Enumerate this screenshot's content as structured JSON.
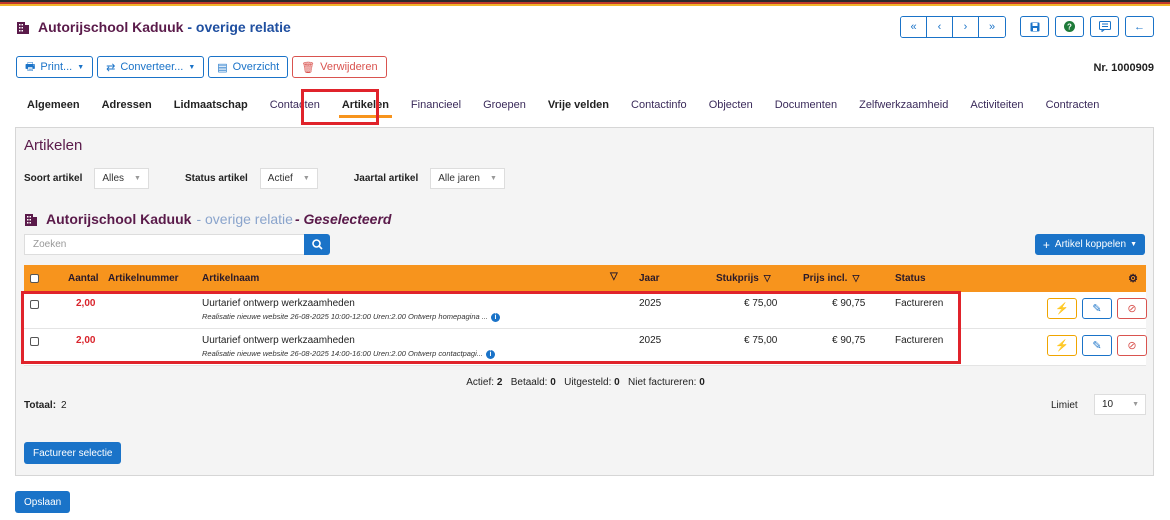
{
  "header": {
    "title": "Autorijschool Kaduuk",
    "subtitle": "- overige relatie",
    "nav_icons": [
      "double-chevron-left-icon",
      "chevron-left-icon",
      "chevron-right-icon",
      "double-chevron-right-icon"
    ],
    "action_icons": [
      "save-icon",
      "help-icon",
      "comment-icon",
      "arrow-left-icon"
    ]
  },
  "toolbar": {
    "print_label": "Print...",
    "convert_label": "Converteer...",
    "overview_label": "Overzicht",
    "delete_label": "Verwijderen",
    "record_number": "Nr. 1000909"
  },
  "tabs": [
    {
      "label": "Algemeen"
    },
    {
      "label": "Adressen"
    },
    {
      "label": "Lidmaatschap"
    },
    {
      "label": "Contacten"
    },
    {
      "label": "Artikelen"
    },
    {
      "label": "Financieel"
    },
    {
      "label": "Groepen"
    },
    {
      "label": "Vrije velden"
    },
    {
      "label": "Contactinfo"
    },
    {
      "label": "Objecten"
    },
    {
      "label": "Documenten"
    },
    {
      "label": "Zelfwerkzaamheid"
    },
    {
      "label": "Activiteiten"
    },
    {
      "label": "Contracten"
    }
  ],
  "panel": {
    "title": "Artikelen",
    "filters": {
      "soort_label": "Soort artikel",
      "soort_value": "Alles",
      "status_label": "Status artikel",
      "status_value": "Actief",
      "jaartal_label": "Jaartal artikel",
      "jaartal_value": "Alle jaren"
    },
    "subheader": {
      "name": "Autorijschool Kaduuk",
      "type": "- overige relatie",
      "selected": "- Geselecteerd"
    },
    "search_placeholder": "Zoeken",
    "koppelen_label": "Artikel koppelen"
  },
  "table": {
    "columns": {
      "aantal": "Aantal",
      "artikelnummer": "Artikelnummer",
      "artikelnaam": "Artikelnaam",
      "jaar": "Jaar",
      "stukprijs": "Stukprijs",
      "prijs_incl": "Prijs incl.",
      "status": "Status"
    },
    "rows": [
      {
        "aantal": "2,00",
        "artikelnummer": "",
        "artikelnaam": "Uurtarief ontwerp werkzaamheden",
        "omschrijving": "Realisatie nieuwe website 26-08-2025 10:00-12:00 Uren:2.00 Ontwerp homepagina ...",
        "jaar": "2025",
        "stukprijs": "€ 75,00",
        "prijs_incl": "€ 90,75",
        "status": "Factureren"
      },
      {
        "aantal": "2,00",
        "artikelnummer": "",
        "artikelnaam": "Uurtarief ontwerp werkzaamheden",
        "omschrijving": "Realisatie nieuwe website 26-08-2025 14:00-16:00 Uren:2.00 Ontwerp contactpagi...",
        "jaar": "2025",
        "stukprijs": "€ 75,00",
        "prijs_incl": "€ 90,75",
        "status": "Factureren"
      }
    ]
  },
  "summary": {
    "actief_label": "Actief:",
    "actief_value": "2",
    "betaald_label": "Betaald:",
    "betaald_value": "0",
    "uitgesteld_label": "Uitgesteld:",
    "uitgesteld_value": "0",
    "niet_label": "Niet factureren:",
    "niet_value": "0"
  },
  "totals": {
    "totaal_label": "Totaal:",
    "totaal_value": "2",
    "limiet_label": "Limiet",
    "limiet_value": "10"
  },
  "buttons": {
    "factureer_label": "Factureer selectie",
    "opslaan_label": "Opslaan"
  },
  "colors": {
    "accent": "#1a73c8",
    "table_header": "#f7941d",
    "highlight": "#e0232b",
    "title": "#5a1a4a"
  }
}
